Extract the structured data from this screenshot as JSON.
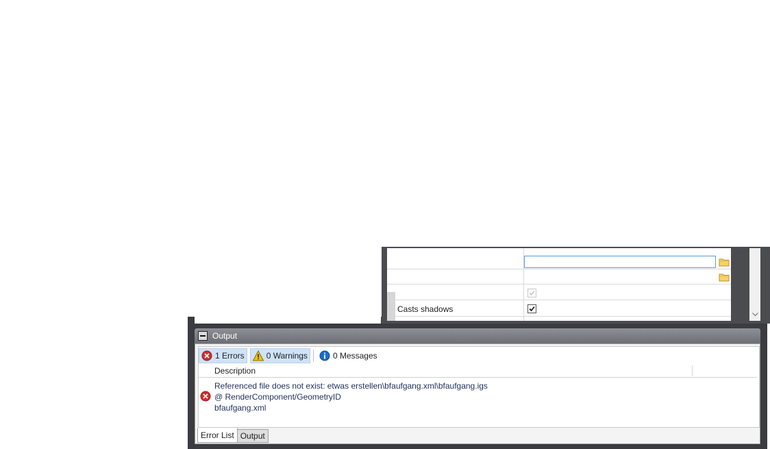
{
  "properties": {
    "casts_shadows_label": "Casts shadows",
    "casts_shadows_checked": true
  },
  "output": {
    "title": "Output",
    "filters": {
      "errors_label": "1 Errors",
      "warnings_label": "0 Warnings",
      "messages_label": "0 Messages"
    },
    "columns": {
      "description": "Description"
    },
    "errors": [
      {
        "line1": "Referenced file does not exist: etwas erstellen\\bfaufgang.xml\\bfaufgang.igs",
        "line2": "@ RenderComponent/GeometryID",
        "line3": "bfaufgang.xml"
      }
    ],
    "tabs": [
      {
        "label": "Error List",
        "active": true
      },
      {
        "label": "Output",
        "active": false
      }
    ]
  },
  "colors": {
    "error_red": "#d0312d",
    "warning_yellow": "#f2c200",
    "info_blue": "#1c6fc8",
    "header_gray": "#7d8086"
  },
  "icons": [
    "error-icon",
    "warning-icon",
    "info-icon",
    "folder-icon",
    "check-icon",
    "chevron-down-icon",
    "collapse-icon"
  ]
}
